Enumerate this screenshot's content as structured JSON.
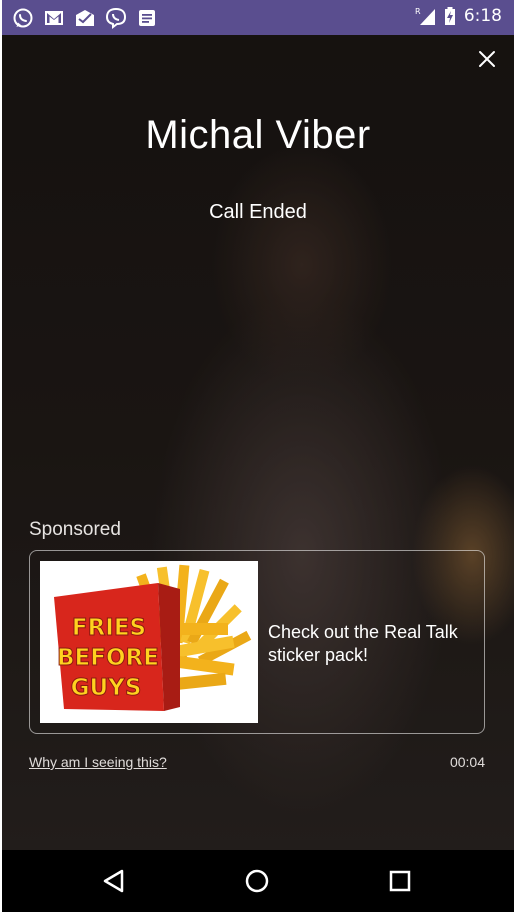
{
  "status_bar": {
    "time": "6:18",
    "left_icons": [
      "whatsapp-icon",
      "gmail-icon",
      "inbox-icon",
      "viber-icon",
      "notes-icon"
    ],
    "right_icons": [
      "signal-roaming-icon",
      "battery-charging-icon"
    ],
    "bar_color": "#5a4e8f"
  },
  "call": {
    "contact_name": "Michal Viber",
    "status": "Call Ended"
  },
  "ad": {
    "sponsored_label": "Sponsored",
    "image_text": [
      "FRIES",
      "BEFORE",
      "GUYS"
    ],
    "description": "Check out the Real Talk sticker pack!",
    "why_link": "Why am I seeing this?",
    "duration": "00:04"
  },
  "nav_bar": {
    "buttons": [
      "back-icon",
      "home-icon",
      "recents-icon"
    ]
  }
}
